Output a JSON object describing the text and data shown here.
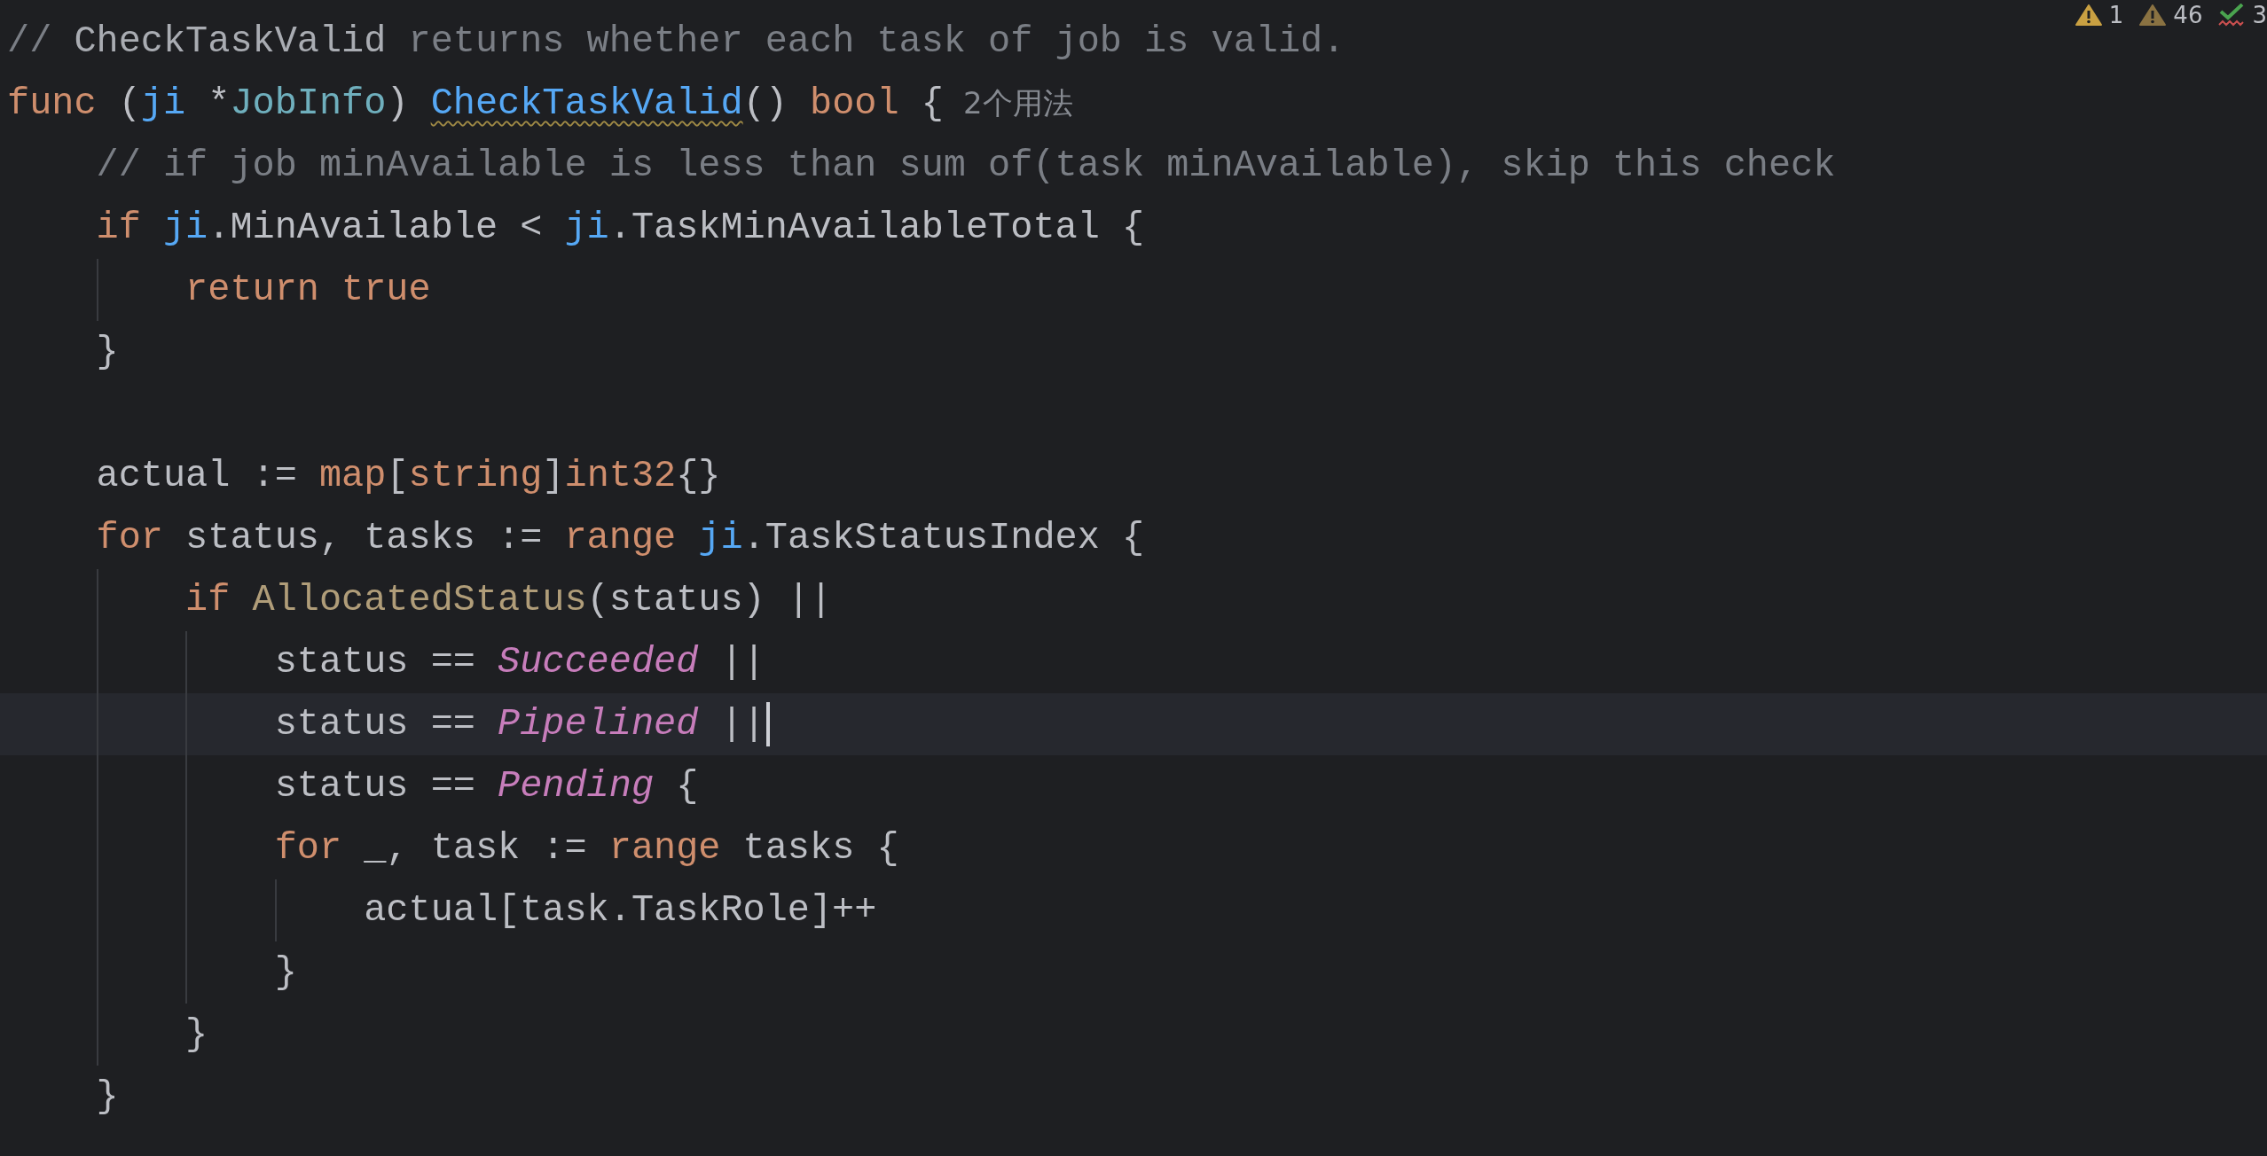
{
  "inspection_widget": [
    {
      "kind": "warning",
      "count": "1"
    },
    {
      "kind": "weak_warning",
      "count": "46"
    },
    {
      "kind": "typo",
      "count": "3"
    }
  ],
  "lines": [
    {
      "current": false,
      "tokens": [
        {
          "kind": "comment",
          "text": "// "
        },
        {
          "kind": "comment_ref",
          "text": "CheckTaskValid"
        },
        {
          "kind": "comment",
          "text": " returns whether each task of job is valid."
        }
      ]
    },
    {
      "current": false,
      "tokens": [
        {
          "kind": "keyword",
          "text": "func"
        },
        {
          "kind": "plain",
          "text": " ("
        },
        {
          "kind": "receiver",
          "text": "ji"
        },
        {
          "kind": "plain",
          "text": " *"
        },
        {
          "kind": "type",
          "text": "JobInfo"
        },
        {
          "kind": "plain",
          "text": ") "
        },
        {
          "kind": "func_decl",
          "text": "CheckTaskValid"
        },
        {
          "kind": "plain",
          "text": "() "
        },
        {
          "kind": "keyword",
          "text": "bool"
        },
        {
          "kind": "plain",
          "text": " {"
        }
      ],
      "hint": "2个用法"
    },
    {
      "current": false,
      "tokens": [
        {
          "kind": "comment",
          "text": "    // if job minAvailable is less than sum of(task minAvailable), skip this check"
        }
      ]
    },
    {
      "current": false,
      "tokens": [
        {
          "kind": "keyword",
          "text": "    if "
        },
        {
          "kind": "receiver",
          "text": "ji"
        },
        {
          "kind": "plain",
          "text": ".MinAvailable < "
        },
        {
          "kind": "receiver",
          "text": "ji"
        },
        {
          "kind": "plain",
          "text": ".TaskMinAvailableTotal {"
        }
      ]
    },
    {
      "current": false,
      "tokens": [
        {
          "kind": "keyword",
          "text": "        return true"
        }
      ]
    },
    {
      "current": false,
      "tokens": [
        {
          "kind": "plain",
          "text": "    }"
        }
      ]
    },
    {
      "current": false
    },
    {
      "current": false,
      "tokens": [
        {
          "kind": "plain",
          "text": "    actual := "
        },
        {
          "kind": "keyword",
          "text": "map"
        },
        {
          "kind": "plain",
          "text": "["
        },
        {
          "kind": "keyword",
          "text": "string"
        },
        {
          "kind": "plain",
          "text": "]"
        },
        {
          "kind": "keyword",
          "text": "int32"
        },
        {
          "kind": "plain",
          "text": "{}"
        }
      ]
    },
    {
      "current": false,
      "tokens": [
        {
          "kind": "keyword",
          "text": "    for"
        },
        {
          "kind": "plain",
          "text": " status, tasks := "
        },
        {
          "kind": "keyword",
          "text": "range "
        },
        {
          "kind": "receiver",
          "text": "ji"
        },
        {
          "kind": "plain",
          "text": ".TaskStatusIndex {"
        }
      ]
    },
    {
      "current": false,
      "tokens": [
        {
          "kind": "keyword",
          "text": "        if "
        },
        {
          "kind": "func_call",
          "text": "AllocatedStatus"
        },
        {
          "kind": "plain",
          "text": "(status) ||"
        }
      ]
    },
    {
      "current": false,
      "tokens": [
        {
          "kind": "plain",
          "text": "            status == "
        },
        {
          "kind": "constant",
          "text": "Succeeded"
        },
        {
          "kind": "plain",
          "text": " ||"
        }
      ]
    },
    {
      "current": true,
      "tokens": [
        {
          "kind": "plain",
          "text": "            status == "
        },
        {
          "kind": "constant",
          "text": "Pipelined"
        },
        {
          "kind": "plain",
          "text": " ||"
        }
      ]
    },
    {
      "current": false,
      "tokens": [
        {
          "kind": "plain",
          "text": "            status == "
        },
        {
          "kind": "constant",
          "text": "Pending"
        },
        {
          "kind": "plain",
          "text": " {"
        }
      ]
    },
    {
      "current": false,
      "tokens": [
        {
          "kind": "keyword",
          "text": "            for"
        },
        {
          "kind": "plain",
          "text": " _, task := "
        },
        {
          "kind": "keyword",
          "text": "range"
        },
        {
          "kind": "plain",
          "text": " tasks {"
        }
      ]
    },
    {
      "current": false,
      "tokens": [
        {
          "kind": "plain",
          "text": "                actual[task.TaskRole]++"
        }
      ]
    },
    {
      "current": false,
      "tokens": [
        {
          "kind": "plain",
          "text": "            }"
        }
      ]
    },
    {
      "current": false,
      "tokens": [
        {
          "kind": "plain",
          "text": "        }"
        }
      ]
    },
    {
      "current": false,
      "tokens": [
        {
          "kind": "plain",
          "text": "    }"
        }
      ]
    }
  ]
}
